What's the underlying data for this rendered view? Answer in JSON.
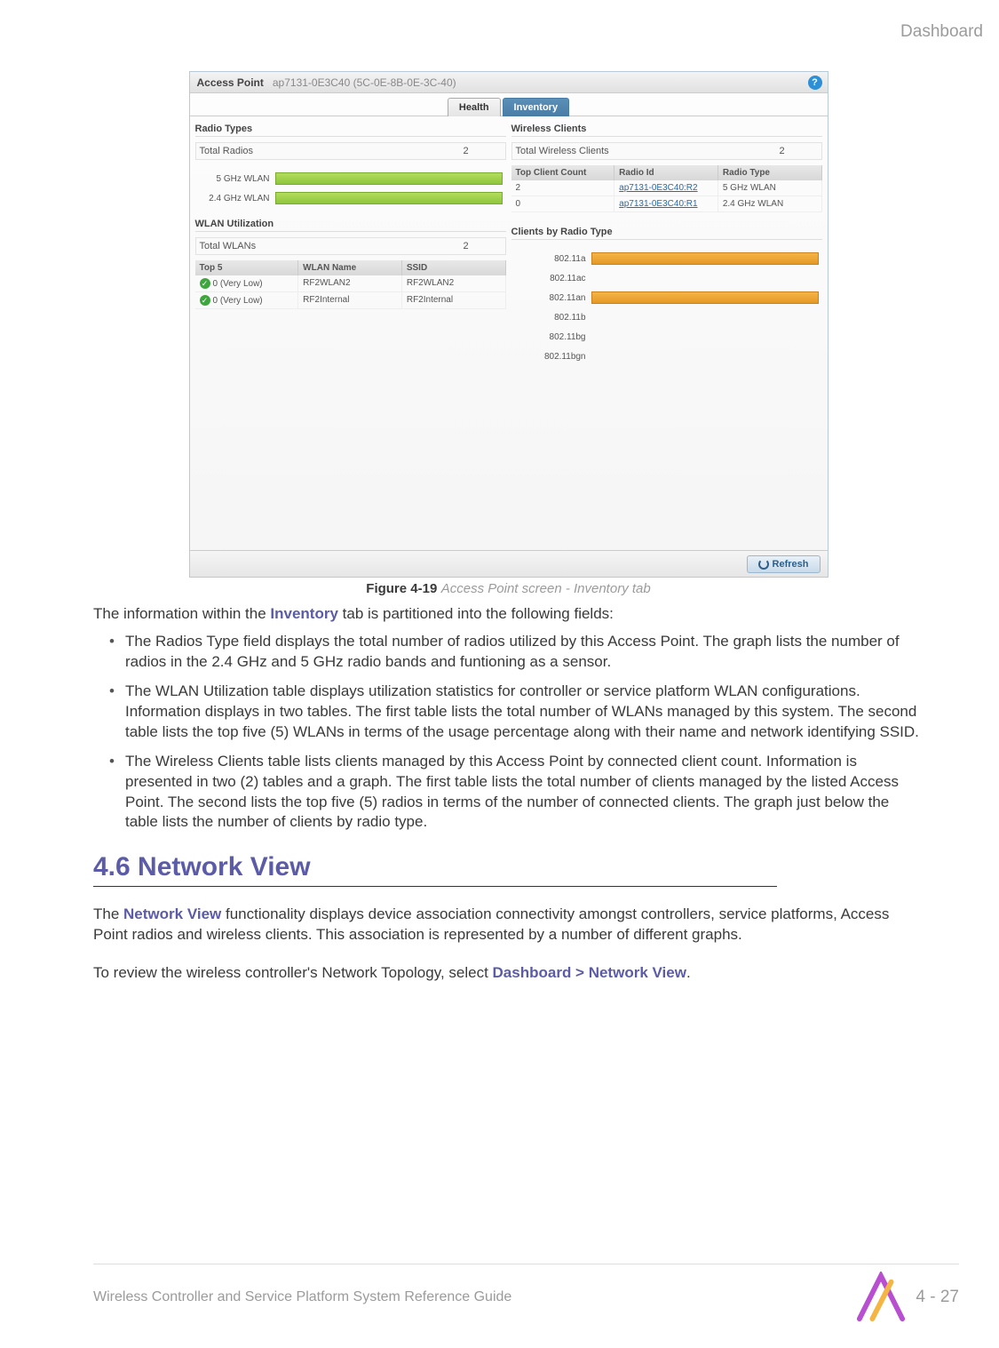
{
  "header": {
    "section": "Dashboard"
  },
  "screenshot": {
    "title_label": "Access Point",
    "device_name": "ap7131-0E3C40 (5C-0E-8B-0E-3C-40)",
    "help_glyph": "?",
    "tabs": {
      "health": "Health",
      "inventory": "Inventory"
    },
    "radio_types": {
      "title": "Radio Types",
      "total_label": "Total Radios",
      "total_value": "2",
      "rows": [
        {
          "label": "5 GHz WLAN"
        },
        {
          "label": "2.4 GHz WLAN"
        }
      ]
    },
    "wlan_util": {
      "title": "WLAN Utilization",
      "total_label": "Total WLANs",
      "total_value": "2",
      "headers": {
        "c1": "Top 5",
        "c2": "WLAN Name",
        "c3": "SSID"
      },
      "rows": [
        {
          "score": "0 (Very Low)",
          "name": "RF2WLAN2",
          "ssid": "RF2WLAN2"
        },
        {
          "score": "0 (Very Low)",
          "name": "RF2Internal",
          "ssid": "RF2Internal"
        }
      ]
    },
    "wireless_clients": {
      "title": "Wireless Clients",
      "total_label": "Total Wireless Clients",
      "total_value": "2",
      "headers": {
        "c1": "Top Client Count",
        "c2": "Radio Id",
        "c3": "Radio Type"
      },
      "rows": [
        {
          "count": "2",
          "radio": "ap7131-0E3C40:R2",
          "type": "5 GHz WLAN"
        },
        {
          "count": "0",
          "radio": "ap7131-0E3C40:R1",
          "type": "2.4 GHz WLAN"
        }
      ]
    },
    "clients_by_type": {
      "title": "Clients by Radio Type",
      "rows": [
        {
          "label": "802.11a",
          "bar": true
        },
        {
          "label": "802.11ac",
          "bar": false
        },
        {
          "label": "802.11an",
          "bar": true
        },
        {
          "label": "802.11b",
          "bar": false
        },
        {
          "label": "802.11bg",
          "bar": false
        },
        {
          "label": "802.11bgn",
          "bar": false
        }
      ]
    },
    "refresh": "Refresh"
  },
  "figure": {
    "number": "Figure 4-19",
    "caption": "Access Point screen - Inventory tab"
  },
  "intro": {
    "pre": "The information within the ",
    "kw": "Inventory",
    "post": " tab is partitioned into the following fields:"
  },
  "bullets": [
    {
      "pre": "The ",
      "kw": "Radios Type",
      "post": " field displays the total number of radios utilized by this Access Point. The graph lists the number of radios in the 2.4 GHz and 5 GHz radio bands and funtioning as a sensor."
    },
    {
      "pre": "The ",
      "kw": "WLAN Utilization",
      "post": " table displays utilization statistics for controller or service platform WLAN configurations. Information displays in two tables. The first table lists the total number of WLANs managed by this system. The second table lists the top five (5) WLANs in terms of the usage percentage along with their name and network identifying SSID."
    },
    {
      "pre": "The ",
      "kw": "Wireless Clients",
      "post": " table lists clients managed by this Access Point by connected client count. Information is presented in two (2) tables and a graph. The first table lists the total number of clients managed by the listed Access Point. The second lists the top five (5) radios in terms of the number of connected clients. The graph just below the table lists the number of clients by radio type."
    }
  ],
  "section": {
    "heading": "4.6 Network View"
  },
  "para1": {
    "pre": "The ",
    "kw": "Network View",
    "post": " functionality displays device association connectivity amongst controllers, service platforms, Access Point radios and wireless clients. This association is represented by a number of different graphs."
  },
  "para2": {
    "pre": "To review the wireless controller's Network Topology, select ",
    "kw": "Dashboard > Network View",
    "post": "."
  },
  "footer": {
    "text": "Wireless Controller and Service Platform System Reference Guide",
    "page": "4 - 27"
  }
}
